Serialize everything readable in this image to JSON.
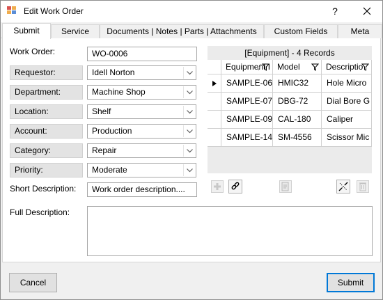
{
  "window": {
    "title": "Edit Work Order",
    "help_label": "?",
    "close_label": "✕"
  },
  "tabs": [
    {
      "label": "Submit"
    },
    {
      "label": "Service"
    },
    {
      "label": "Documents | Notes | Parts | Attachments"
    },
    {
      "label": "Custom Fields"
    },
    {
      "label": "Meta"
    }
  ],
  "form": {
    "work_order": {
      "label": "Work Order:",
      "value": "WO-0006"
    },
    "requestor": {
      "label": "Requestor:",
      "value": "Idell Norton"
    },
    "department": {
      "label": "Department:",
      "value": "Machine Shop"
    },
    "location": {
      "label": "Location:",
      "value": "Shelf"
    },
    "account": {
      "label": "Account:",
      "value": "Production"
    },
    "category": {
      "label": "Category:",
      "value": "Repair"
    },
    "priority": {
      "label": "Priority:",
      "value": "Moderate"
    },
    "short_description": {
      "label": "Short Description:",
      "value": "Work order description...."
    },
    "full_description": {
      "label": "Full Description:",
      "value": ""
    }
  },
  "equipment_grid": {
    "caption": "[Equipment] - 4 Records",
    "columns": [
      "Equipment I",
      "Model",
      "Descriptio"
    ],
    "rows": [
      [
        "SAMPLE-06",
        "HMIC32",
        "Hole Micro"
      ],
      [
        "SAMPLE-07",
        "DBG-72",
        "Dial Bore G"
      ],
      [
        "SAMPLE-09",
        "CAL-180",
        "Caliper"
      ],
      [
        "SAMPLE-14",
        "SM-4556",
        "Scissor Mic"
      ]
    ],
    "selected_row": 0
  },
  "toolbar_icons": [
    "add-icon",
    "link-icon",
    "edit-document-icon",
    "unlink-icon",
    "delete-icon"
  ],
  "buttons": {
    "cancel": "Cancel",
    "submit": "Submit"
  },
  "colors": {
    "accent": "#0078d7",
    "label_bg": "#e3e3e3",
    "window_bg": "#f0f0f0"
  }
}
